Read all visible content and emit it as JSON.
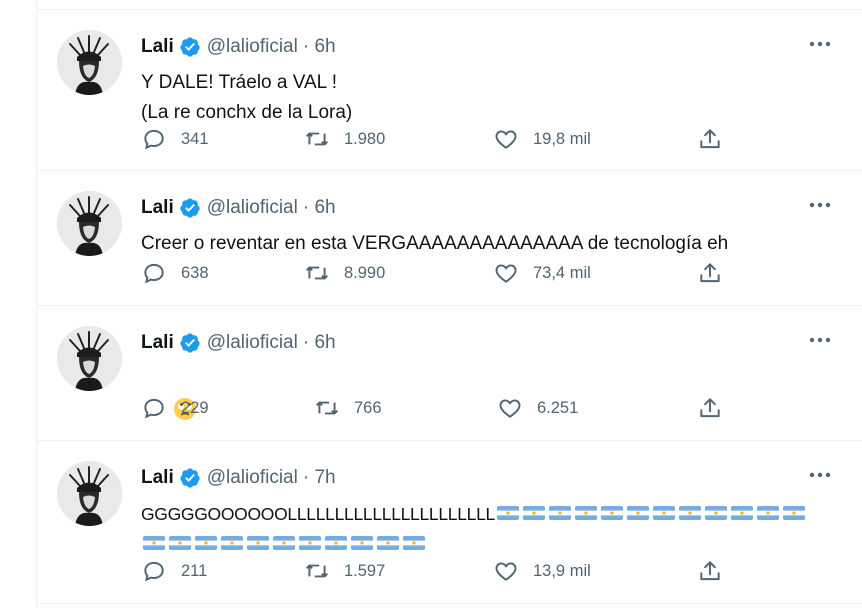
{
  "tweets": [
    {
      "name": "Lali",
      "handle": "@lalioficial",
      "time": "· 6h",
      "text_lines": [
        "Y DALE! Tráelo a VAL !",
        "(La re conchx de la Lora)"
      ],
      "replies": "341",
      "retweets": "1.980",
      "likes": "19,8 mil"
    },
    {
      "name": "Lali",
      "handle": "@lalioficial",
      "time": "· 6h",
      "text_lines": [
        "Creer o reventar en esta VERGAAAAAAAAAAAAAA de tecnología eh"
      ],
      "replies": "638",
      "retweets": "8.990",
      "likes": "73,4 mil"
    },
    {
      "name": "Lali",
      "handle": "@lalioficial",
      "time": "· 6h",
      "emoji": "rolling-eyes-face",
      "replies": "229",
      "retweets": "766",
      "likes": "6.251"
    },
    {
      "name": "Lali",
      "handle": "@lalioficial",
      "time": "· 7h",
      "text_lines": [
        "GGGGGOOOOOOLLLLLLLLLLLLLLLLLLLLLL"
      ],
      "flags_line1": 12,
      "flags_line2": 11,
      "flag_emoji": "argentina-flag",
      "replies": "211",
      "retweets": "1.597",
      "likes": "13,9 mil"
    }
  ],
  "colors": {
    "text": "#0f1419",
    "secondary": "#536471",
    "verified": "#1d9bf0",
    "divider": "#eff3f4"
  }
}
